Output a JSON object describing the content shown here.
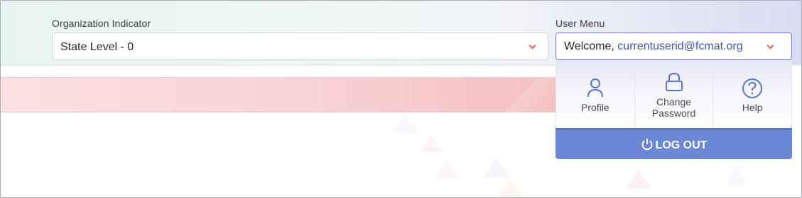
{
  "organization": {
    "label": "Organization Indicator",
    "selected": "State Level - 0"
  },
  "user_menu": {
    "label": "User Menu",
    "welcome": "Welcome,",
    "email": "currentuserid@fcmat.org",
    "items": [
      {
        "label": "Profile",
        "icon": "user-icon"
      },
      {
        "label_line1": "Change",
        "label_line2": "Password",
        "icon": "lock-icon"
      },
      {
        "label": "Help",
        "icon": "help-icon"
      }
    ],
    "logout": "LOG OUT"
  },
  "colors": {
    "accent": "#6b88d6",
    "chevron": "#e0605f",
    "email": "#3f57b5",
    "alert": "#f8d2d4"
  }
}
